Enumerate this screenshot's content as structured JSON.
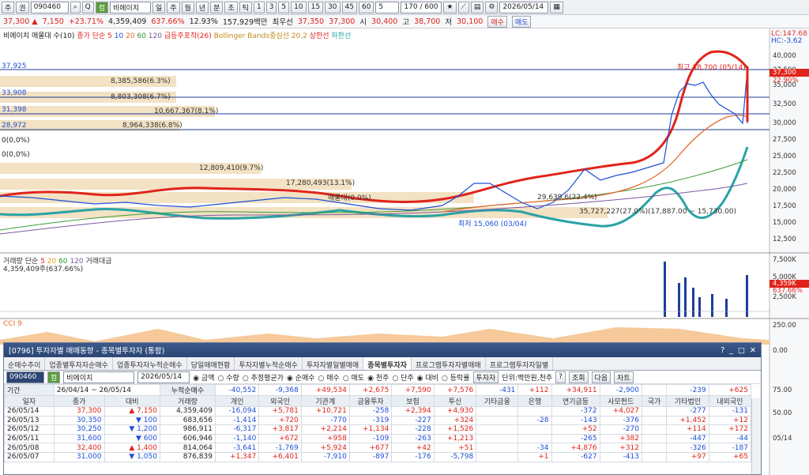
{
  "toolbar1": {
    "mode_a": "주",
    "mode_b": "권",
    "code": "090460",
    "name": "비에이치",
    "chip": "컴",
    "periods": [
      "일",
      "주",
      "월",
      "년",
      "분",
      "초",
      "틱"
    ],
    "mins": [
      "1",
      "3",
      "5",
      "10",
      "15",
      "30",
      "45",
      "60"
    ],
    "min_sel": "5",
    "count": "170 / 600",
    "date": "2026/05/14"
  },
  "quote": {
    "price": "37,300",
    "arrow": "▲",
    "change": "7,150",
    "pct": "+23.71%",
    "volume": "4,359,409",
    "vol_pct": "637.66%",
    "turnover": "12.93%",
    "amount": "157,929백만",
    "ceiling_label": "최우선",
    "ask": "37,350",
    "bid": "37,300",
    "open_label": "시",
    "open": "30,400",
    "high_label": "고",
    "high": "38,700",
    "low_label": "저",
    "low": "30,100",
    "buy": "매수",
    "sell": "매도"
  },
  "price_legend": {
    "name": "비에이치 매물대 수(10)",
    "ma": "종가 단순",
    "ma_periods": [
      "5",
      "10",
      "20",
      "60",
      "120"
    ],
    "bb_head": "급등주포착(26)",
    "bb": "Bollinger Bands중심선 20,2",
    "upper": "상한선",
    "lower": "하한선"
  },
  "axis_labels": {
    "left_levels": [
      "37,925",
      "33,908",
      "31,398",
      "28,972",
      "0(0,0%)",
      "0(0,0%)"
    ],
    "right_ticks": [
      "40,000",
      "37,500",
      "35,000",
      "32,500",
      "30,000",
      "27,500",
      "25,000",
      "22,500",
      "20,000",
      "17,500",
      "15,000",
      "12,500"
    ],
    "right_top": [
      "LC:147.68",
      "HC:-3.62"
    ],
    "price_tag": "37,300",
    "price_pct": "22.90%",
    "vol_ticks": [
      "7,500K",
      "5,000K",
      "2,500K"
    ],
    "vol_tag": "4,359K",
    "vol_pct": "637.66%",
    "cci_ticks": [
      "250.00",
      "0.00",
      "75.00",
      "50.00"
    ],
    "date_tag": "05/14"
  },
  "volume_profile": [
    {
      "label": "8,385,586(6.3%)"
    },
    {
      "label": "8,803,308(6.7%)"
    },
    {
      "label": "10,667,367(8.1%)"
    },
    {
      "label": "8,964,338(6.8%)"
    },
    {
      "label": "12,809,410(9.7%)"
    },
    {
      "label": "17,280,493(13.1%)"
    },
    {
      "label": "매물대(0.0%)"
    },
    {
      "label": "29,639,6(22.4%)"
    },
    {
      "label": "35,727,227(27.0%)(17,887.00 ~ 15,730.00)"
    }
  ],
  "annotations": {
    "high": "최고 38,700 (05/14)",
    "low": "최저 15,060 (03/04)"
  },
  "volume_legend": {
    "title": "거래량 단순",
    "periods": [
      "5",
      "20",
      "60",
      "120"
    ],
    "amt": "거래대금",
    "value": "4,359,409주(637.66%)"
  },
  "cci_legend": "CCI 9",
  "dialog": {
    "title": "[0796] 투자자별 매매동향 - 종목별투자자 (통합)",
    "tabs": [
      "순매수추이",
      "업종별투자자순매수",
      "업종투자자누적순매수",
      "당일매매현황",
      "투자자별누적순매수",
      "투자자별일별매매",
      "종목별투자자",
      "프로그램투자자별매매",
      "프로그램투자자일별"
    ],
    "code": "090460",
    "chip": "컴",
    "name": "비에이치",
    "date": "2026/05/14",
    "radios1": [
      "금액",
      "수량",
      "추정평균가"
    ],
    "radios2": [
      "순매수",
      "매수",
      "매도"
    ],
    "radios3": [
      "천주",
      "단주"
    ],
    "radios4": [
      "대비",
      "등락률"
    ],
    "btn_investor": "투자자",
    "unit": "단위:백만원,천주",
    "btn_help": "?",
    "btn_query": "조회",
    "btn_next": "다음",
    "btn_chart": "차트",
    "period_label": "기간",
    "from": "26/04/14",
    "to": "26/05/14",
    "cum_label": "누적순매수",
    "cum": [
      "-40,552",
      "-9,368",
      "+49,534",
      "+2,675",
      "+7,590",
      "+7,576",
      "-431",
      "+112",
      "+34,911",
      "-2,900",
      "",
      "-239",
      "+625"
    ],
    "headers": [
      "일자",
      "종가",
      "대비",
      "거래량",
      "개인",
      "외국인",
      "기관계",
      "금융투자",
      "보험",
      "투신",
      "기타금융",
      "은행",
      "연기금등",
      "사모펀드",
      "국가",
      "기타법인",
      "내외국인"
    ],
    "rows": [
      [
        "26/05/14",
        "37,300",
        "▲",
        "7,150",
        "4,359,409",
        "-16,094",
        "+5,781",
        "+10,721",
        "-258",
        "+2,394",
        "+4,930",
        "",
        "",
        "-372",
        "+4,027",
        "",
        "-277",
        "-131"
      ],
      [
        "26/05/13",
        "30,350",
        "▼",
        "100",
        "683,656",
        "-1,414",
        "+720",
        "-770",
        "-319",
        "-227",
        "+324",
        "",
        "-28",
        "-143",
        "-376",
        "",
        "+1,452",
        "+12"
      ],
      [
        "26/05/12",
        "30,250",
        "▼",
        "1,200",
        "986,911",
        "-6,317",
        "+3,817",
        "+2,214",
        "+1,134",
        "-228",
        "+1,526",
        "",
        "",
        "+52",
        "-270",
        "",
        "+114",
        "+172"
      ],
      [
        "26/05/11",
        "31,600",
        "▼",
        "600",
        "606,946",
        "-1,140",
        "+672",
        "+958",
        "-109",
        "-263",
        "+1,213",
        "",
        "",
        "-265",
        "+382",
        "",
        "-447",
        "-44"
      ],
      [
        "26/05/08",
        "32,400",
        "▲",
        "1,400",
        "814,064",
        "-3,641",
        "-1,769",
        "+5,924",
        "+677",
        "+42",
        "+51",
        "",
        "-34",
        "+4,876",
        "+312",
        "",
        "-326",
        "-187"
      ],
      [
        "26/05/07",
        "31,000",
        "▼",
        "1,050",
        "876,839",
        "+1,347",
        "+6,401",
        "-7,910",
        "-897",
        "-176",
        "-5,798",
        "",
        "+1",
        "-627",
        "-413",
        "",
        "+97",
        "+65"
      ]
    ]
  }
}
